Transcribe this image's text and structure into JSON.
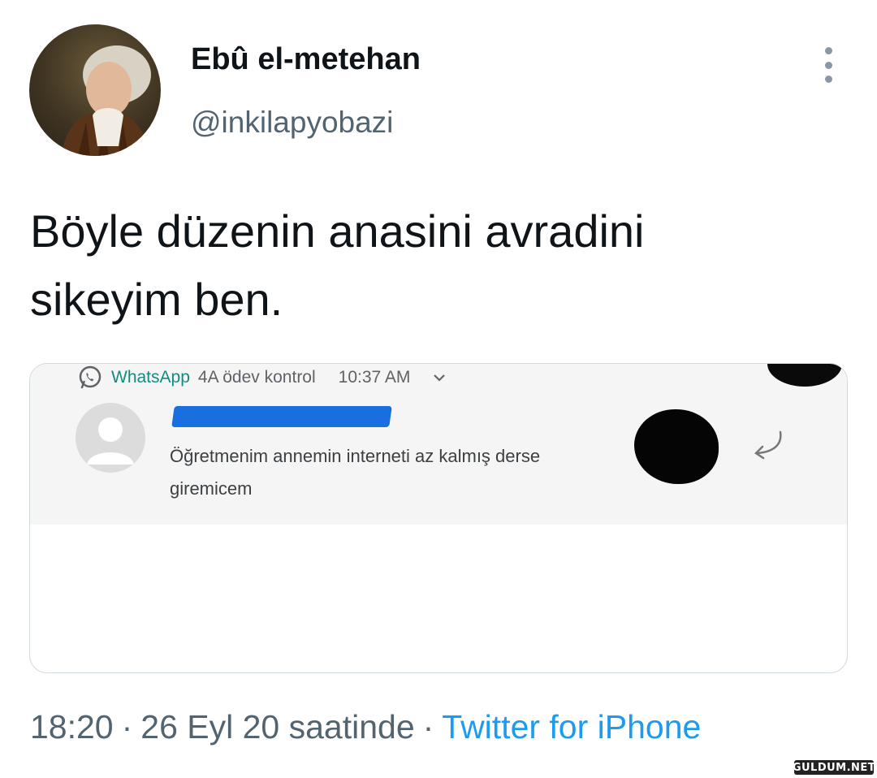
{
  "author": {
    "display_name": "Ebû el-metehan",
    "handle": "@inkilapyobazi"
  },
  "tweet": {
    "text": "Böyle düzenin anasini avradini\nsikeyim ben."
  },
  "media": {
    "notification": {
      "app_name": "WhatsApp",
      "group": "4A ödev kontrol",
      "time": "10:37 AM",
      "message": "Öğretmenim annemin interneti az kalmış derse\ngiremicem"
    }
  },
  "meta": {
    "time": "18:20",
    "date": "26 Eyl 20 saatinde",
    "separator": "·",
    "source": "Twitter for iPhone"
  },
  "watermark": "GULDUM.NET",
  "colors": {
    "link": "#1d9bf0",
    "secondary_text": "#536471",
    "redaction": "#1a6fe0"
  }
}
